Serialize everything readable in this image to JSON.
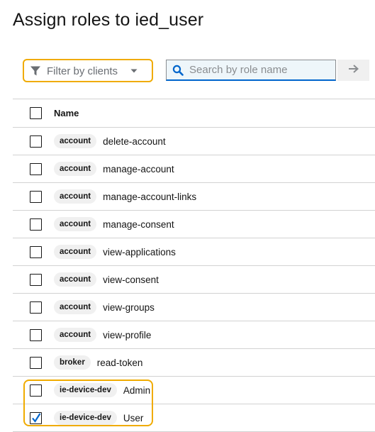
{
  "page": {
    "title": "Assign roles to ied_user"
  },
  "toolbar": {
    "filter_label": "Filter by clients",
    "search_placeholder": "Search by role name",
    "search_value": ""
  },
  "table": {
    "header_name": "Name",
    "rows": [
      {
        "client": "account",
        "role": "delete-account",
        "checked": false
      },
      {
        "client": "account",
        "role": "manage-account",
        "checked": false
      },
      {
        "client": "account",
        "role": "manage-account-links",
        "checked": false
      },
      {
        "client": "account",
        "role": "manage-consent",
        "checked": false
      },
      {
        "client": "account",
        "role": "view-applications",
        "checked": false
      },
      {
        "client": "account",
        "role": "view-consent",
        "checked": false
      },
      {
        "client": "account",
        "role": "view-groups",
        "checked": false
      },
      {
        "client": "account",
        "role": "view-profile",
        "checked": false
      },
      {
        "client": "broker",
        "role": "read-token",
        "checked": false
      },
      {
        "client": "ie-device-dev",
        "role": "Admin",
        "checked": false
      },
      {
        "client": "ie-device-dev",
        "role": "User",
        "checked": true
      }
    ]
  },
  "colors": {
    "highlight": "#f0ab00",
    "search_bg": "#eef6fa",
    "accent": "#0066cc",
    "badge_bg": "#f0f0f0"
  },
  "icons": {
    "filter": "filter-icon",
    "caret": "caret-down-icon",
    "search": "search-icon",
    "go": "arrow-right-icon",
    "check": "check-icon"
  }
}
